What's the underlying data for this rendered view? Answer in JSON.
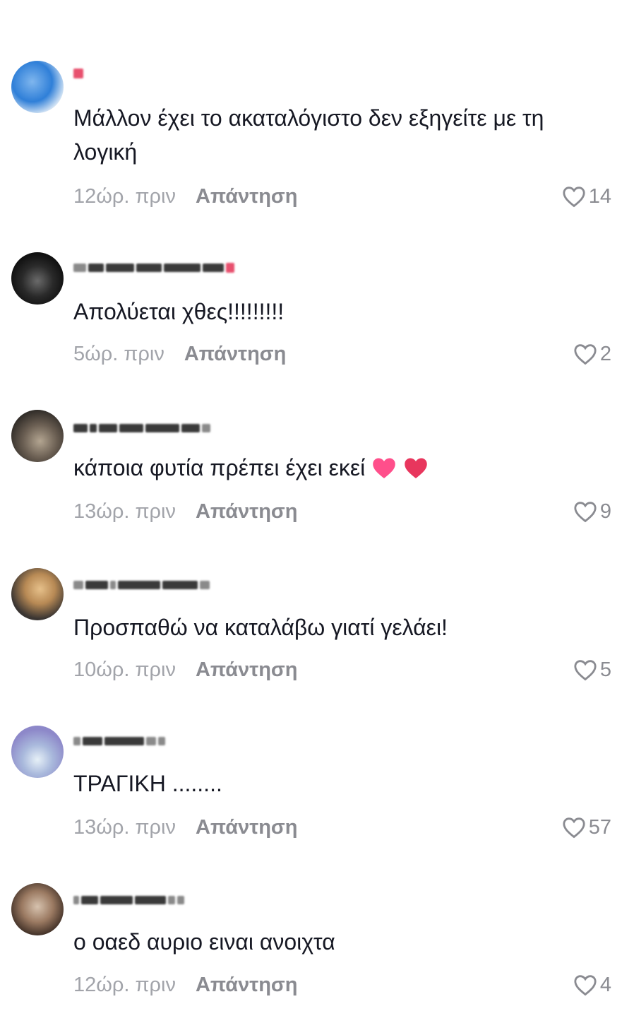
{
  "comments": [
    {
      "text": "Μάλλον έχει το ακαταλόγιστο δεν εξηγείτε με τη λογική",
      "time": "12ώρ. πριν",
      "reply": "Απάντηση",
      "likes": "14",
      "avatar_colors": [
        "#2f7fd8",
        "#d7e6f5"
      ]
    },
    {
      "text": "Απολύεται χθες!!!!!!!!!",
      "time": "5ώρ. πριν",
      "reply": "Απάντηση",
      "likes": "2",
      "avatar_colors": [
        "#1a1a1a",
        "#6a6a6a"
      ]
    },
    {
      "text": "κάποια φυτία πρέπει έχει εκεί",
      "time": "13ώρ. πριν",
      "reply": "Απάντηση",
      "likes": "9",
      "avatar_colors": [
        "#3d3a36",
        "#9a8f80"
      ]
    },
    {
      "text": "Προσπαθώ να καταλάβω γιατί γελάει!",
      "time": "10ώρ. πριν",
      "reply": "Απάντηση",
      "likes": "5",
      "avatar_colors": [
        "#c9a26a",
        "#3a3532"
      ]
    },
    {
      "text": "ΤΡΑΓΙΚΗ ........",
      "time": "13ώρ. πριν",
      "reply": "Απάντηση",
      "likes": "57",
      "avatar_colors": [
        "#8d88c9",
        "#cfe0ee"
      ]
    },
    {
      "text": "ο οαεδ αυριο ειναι ανοιχτα",
      "time": "12ώρ. πριν",
      "reply": "Απάντηση",
      "likes": "4",
      "avatar_colors": [
        "#6b4c3b",
        "#d6c2ae"
      ]
    }
  ],
  "icons": {
    "like": "heart-outline-icon",
    "emoji_1": "pink-heart-emoji",
    "emoji_2": "red-heart-emoji"
  },
  "colors": {
    "text": "#161823",
    "muted": "#a2a4aa",
    "reply": "#8a8b91",
    "pink_heart": "#ff4f8b",
    "red_heart": "#e8365d"
  }
}
